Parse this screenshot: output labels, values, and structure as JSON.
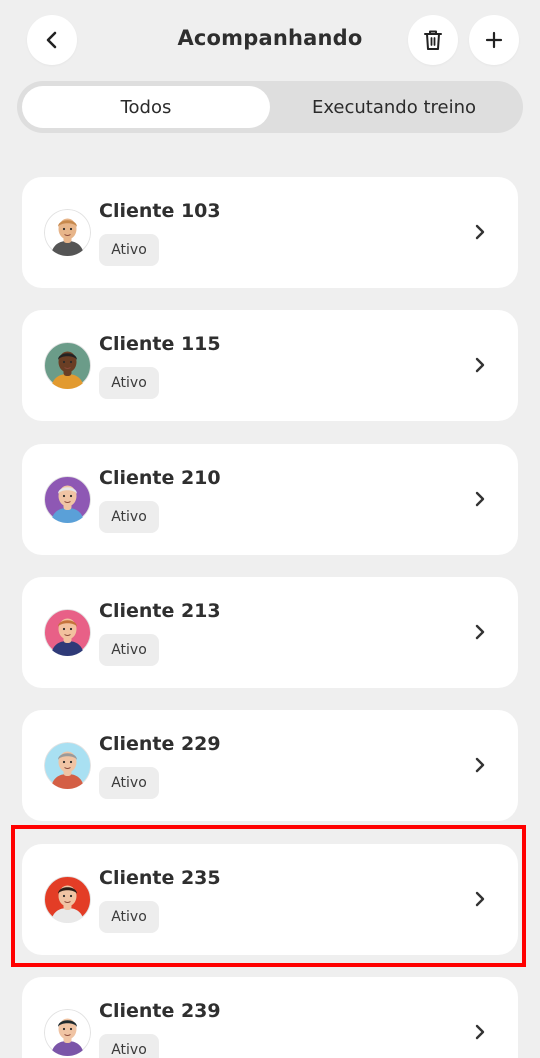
{
  "header": {
    "title": "Acompanhando",
    "back_icon": "chevron-left-icon",
    "delete_icon": "trash-icon",
    "add_icon": "plus-icon"
  },
  "tabs": [
    {
      "label": "Todos",
      "active": true
    },
    {
      "label": "Executando treino",
      "active": false
    }
  ],
  "clients": [
    {
      "name": "Cliente 103",
      "status": "Ativo",
      "avatar_bg": "#ffffff",
      "skin": "#e7b58a",
      "hair": "#c7894d",
      "shirt": "#555555"
    },
    {
      "name": "Cliente 115",
      "status": "Ativo",
      "avatar_bg": "#6b9c89",
      "skin": "#6a3e24",
      "hair": "#222222",
      "shirt": "#e29a2f"
    },
    {
      "name": "Cliente 210",
      "status": "Ativo",
      "avatar_bg": "#8e58b4",
      "skin": "#f0c4a4",
      "hair": "#e6e6e6",
      "shirt": "#5aa0d8"
    },
    {
      "name": "Cliente 213",
      "status": "Ativo",
      "avatar_bg": "#e86087",
      "skin": "#f2c19e",
      "hair": "#c4733a",
      "shirt": "#2f3a78"
    },
    {
      "name": "Cliente 229",
      "status": "Ativo",
      "avatar_bg": "#a9e0f2",
      "skin": "#f0c4a4",
      "hair": "#9a9a9a",
      "shirt": "#d45f45"
    },
    {
      "name": "Cliente 235",
      "status": "Ativo",
      "avatar_bg": "#e33d26",
      "skin": "#f0c4a4",
      "hair": "#2a1c16",
      "shirt": "#e9e9e9"
    },
    {
      "name": "Cliente 239",
      "status": "Ativo",
      "avatar_bg": "#ffffff",
      "skin": "#f0c4a4",
      "hair": "#1f2a2e",
      "shirt": "#7b55a8"
    }
  ]
}
